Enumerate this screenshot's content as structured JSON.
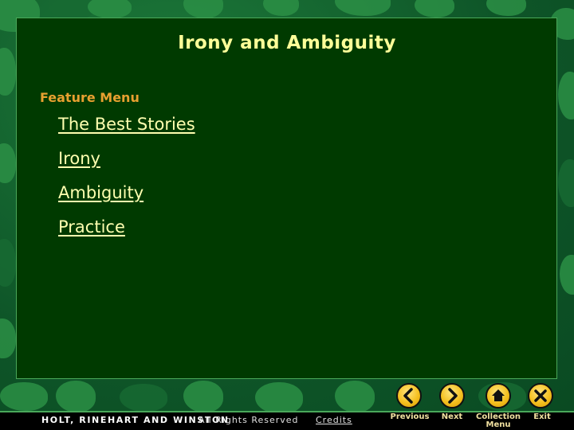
{
  "slide": {
    "title": "Irony and Ambiguity",
    "section_label": "Feature Menu",
    "menu_items": [
      {
        "label": "The Best Stories"
      },
      {
        "label": "Irony"
      },
      {
        "label": "Ambiguity"
      },
      {
        "label": "Practice"
      }
    ]
  },
  "footer": {
    "publisher": "HOLT, RINEHART AND WINSTON",
    "rights": "All Rights Reserved",
    "credits": "Credits"
  },
  "nav": {
    "previous": {
      "label": "Previous",
      "icon": "chevron-left-icon"
    },
    "next": {
      "label": "Next",
      "icon": "chevron-right-icon"
    },
    "collection_menu": {
      "label_line1": "Collection",
      "label_line2": "Menu",
      "icon": "home-icon"
    },
    "exit": {
      "label": "Exit",
      "icon": "close-icon"
    }
  },
  "colors": {
    "panel": "#003a00",
    "title": "#ffff99",
    "section_label": "#e8a030",
    "link": "#ffffb0",
    "button": "#f5c020"
  }
}
